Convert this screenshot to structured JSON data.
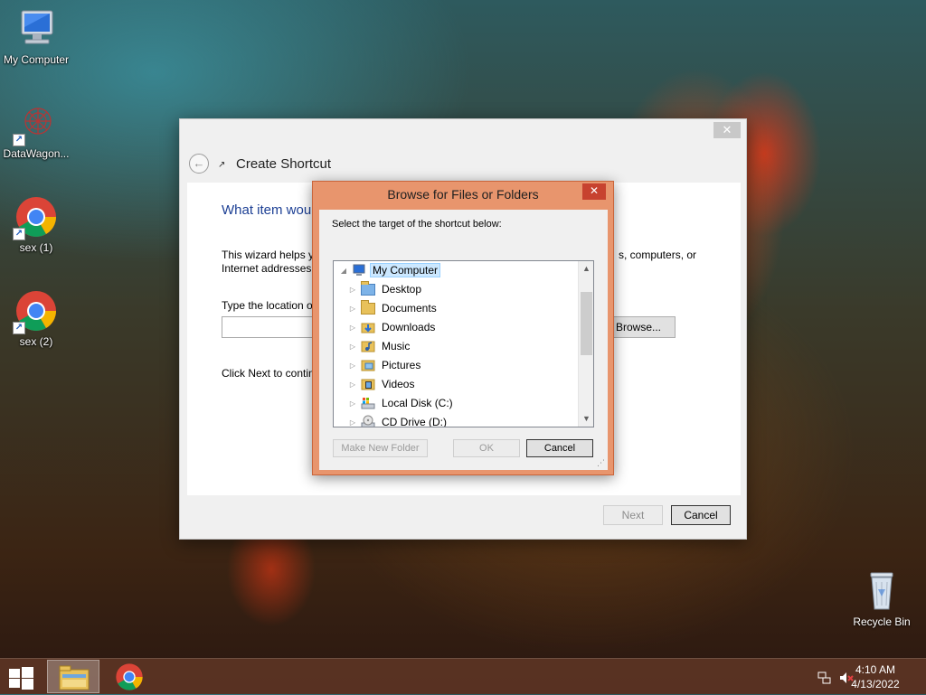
{
  "desktop": {
    "icons": [
      {
        "label": "My Computer",
        "icon": "monitor-icon"
      },
      {
        "label": "DataWagon...",
        "icon": "datawagon-icon"
      },
      {
        "label": "sex (1)",
        "icon": "chrome-icon"
      },
      {
        "label": "sex (2)",
        "icon": "chrome-icon"
      }
    ],
    "recycle_bin": {
      "label": "Recycle Bin",
      "icon": "recycle-bin-icon"
    }
  },
  "wizard": {
    "title": "Create Shortcut",
    "close_label": "✕",
    "back_label": "←",
    "heading": "What item wou",
    "desc_line1": "This wizard helps yo",
    "desc_line1_right": "s, computers, or",
    "desc_line2": "Internet addresses.",
    "type_label": "Type the location o",
    "location_value": "",
    "browse_label": "Browse...",
    "click_next": "Click Next to contin",
    "next_label": "Next",
    "cancel_label": "Cancel"
  },
  "browse_dialog": {
    "title": "Browse for Files or Folders",
    "close_label": "✕",
    "prompt": "Select the target of the shortcut below:",
    "tree": [
      {
        "label": "My Computer",
        "icon": "computer-icon",
        "selected": true,
        "expanded": true
      },
      {
        "label": "Desktop",
        "icon": "folder-icon"
      },
      {
        "label": "Documents",
        "icon": "documents-icon"
      },
      {
        "label": "Downloads",
        "icon": "downloads-icon"
      },
      {
        "label": "Music",
        "icon": "music-icon"
      },
      {
        "label": "Pictures",
        "icon": "pictures-icon"
      },
      {
        "label": "Videos",
        "icon": "videos-icon"
      },
      {
        "label": "Local Disk (C:)",
        "icon": "drive-icon"
      },
      {
        "label": "CD Drive (D:)",
        "icon": "cd-drive-icon"
      }
    ],
    "make_new_folder_label": "Make New Folder",
    "ok_label": "OK",
    "cancel_label": "Cancel"
  },
  "taskbar": {
    "time": "4:10 AM",
    "date": "4/13/2022",
    "apps": [
      {
        "name": "file-explorer",
        "icon": "file-explorer-icon",
        "active": true
      },
      {
        "name": "chrome",
        "icon": "chrome-icon",
        "active": false
      }
    ],
    "tray_icons": [
      "network-icon",
      "volume-muted-icon"
    ]
  },
  "colors": {
    "dialog_accent": "#e8956d",
    "dialog_close": "#c7422f",
    "heading_blue": "#1c3f94",
    "taskbar": "#5c3424"
  }
}
